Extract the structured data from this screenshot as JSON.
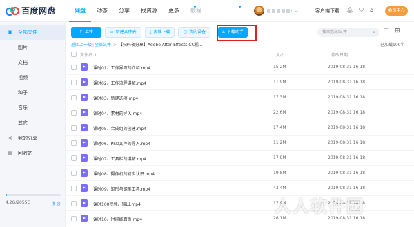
{
  "brand": {
    "name": "百度网盘"
  },
  "nav": [
    {
      "label": "网盘",
      "active": true
    },
    {
      "label": "动态"
    },
    {
      "label": "分享"
    },
    {
      "label": "找资源"
    },
    {
      "label": "更多"
    },
    {
      "label": "教程"
    }
  ],
  "header": {
    "client_download": "客户端下载",
    "member_button": "会员中心",
    "icons": [
      "bell-icon",
      "shirt-icon",
      "gift-icon",
      "menu-icon"
    ]
  },
  "sidebar": {
    "items": [
      {
        "label": "全部文件",
        "icon": "folder-icon"
      },
      {
        "label": "图片"
      },
      {
        "label": "文档"
      },
      {
        "label": "视频"
      },
      {
        "label": "种子"
      },
      {
        "label": "音乐"
      },
      {
        "label": "其它"
      },
      {
        "label": "我的分享",
        "icon": "share-icon"
      },
      {
        "label": "回收站",
        "icon": "trash-icon"
      }
    ],
    "quota": {
      "text": "4.2G/2055G",
      "expand": "扩容",
      "used_fraction": 0.002
    }
  },
  "toolbar": {
    "upload": "上传",
    "new_folder": "新建文件夹",
    "offline_download": "离线下载",
    "my_devices": "我的设备",
    "download_helper": "下载助手",
    "search_placeholder": "搜索您的文件"
  },
  "breadcrumb": {
    "back": "返回上一级",
    "all_files": "全部文件",
    "current": "【扫码夜分享】Adobe After Effects CC视...",
    "loaded": "已加载100个"
  },
  "table": {
    "headers": {
      "name": "文件名",
      "size": "大小",
      "date": "修改日期"
    },
    "rows": [
      {
        "name": "课时01、工作界面的介绍.mp4",
        "size": "15.2M",
        "date": "2019-08-31 16:18"
      },
      {
        "name": "课时02、工作流程讲解.mp4",
        "size": "11.9M",
        "date": "2019-08-31 16:18"
      },
      {
        "name": "课时03、新建选项.mp4",
        "size": "17.3M",
        "date": "2019-08-31 16:18"
      },
      {
        "name": "课时04、素材的导入.mp4",
        "size": "22.6M",
        "date": "2019-08-31 16:18"
      },
      {
        "name": "课时05、合成组的创建.mp4",
        "size": "17.4M",
        "date": "2019-08-31 16:18"
      },
      {
        "name": "课时06、PSD文件的导入.mp4",
        "size": "11.2M",
        "date": "2019-08-31 16:18"
      },
      {
        "name": "课时07、工具栏的讲解.mp4",
        "size": "17.9M",
        "date": "2019-08-31 16:18"
      },
      {
        "name": "课时08、摄像机的初步认识.mp4",
        "size": "19.8M",
        "date": "2019-08-31 16:18"
      },
      {
        "name": "课时09、矩形与钢笔工具.mp4",
        "size": "43.4M",
        "date": "2019-08-31 16:18"
      },
      {
        "name": "课时100视频、输出.mp4",
        "size": "17.9M",
        "date": "2019-08-31 16:18"
      },
      {
        "name": "课时10、时间线面板.mp4",
        "size": "26.1M",
        "date": "2019-08-31 16:18"
      }
    ]
  },
  "watermark": "人人软件园"
}
